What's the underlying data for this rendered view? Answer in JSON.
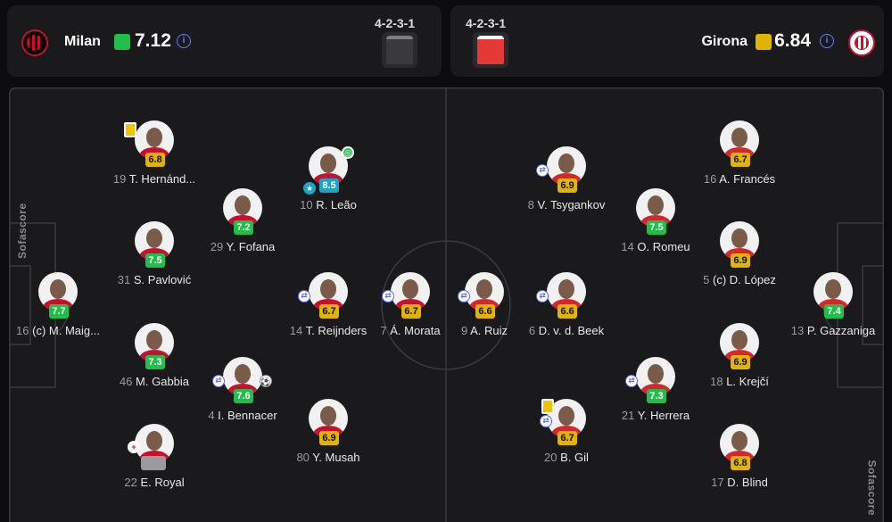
{
  "home": {
    "name": "Milan",
    "rating": "7.12",
    "formation": "4-2-3-1",
    "players": [
      {
        "num": "16",
        "name": "(c) M. Maig...",
        "rating": "7.7",
        "color": "green"
      },
      {
        "num": "19",
        "name": "T. Hernánd...",
        "rating": "6.8",
        "color": "yellow"
      },
      {
        "num": "31",
        "name": "S. Pavlović",
        "rating": "7.5",
        "color": "green"
      },
      {
        "num": "46",
        "name": "M. Gabbia",
        "rating": "7.3",
        "color": "green"
      },
      {
        "num": "22",
        "name": "E. Royal",
        "rating": "",
        "color": "grey"
      },
      {
        "num": "29",
        "name": "Y. Fofana",
        "rating": "7.2",
        "color": "green"
      },
      {
        "num": "4",
        "name": "I. Bennacer",
        "rating": "7.6",
        "color": "green"
      },
      {
        "num": "10",
        "name": "R. Leão",
        "rating": "8.5",
        "color": "teal"
      },
      {
        "num": "14",
        "name": "T. Reijnders",
        "rating": "6.7",
        "color": "yellow"
      },
      {
        "num": "80",
        "name": "Y. Musah",
        "rating": "6.9",
        "color": "yellow"
      },
      {
        "num": "7",
        "name": "Á. Morata",
        "rating": "6.7",
        "color": "yellow"
      }
    ]
  },
  "away": {
    "name": "Girona",
    "rating": "6.84",
    "formation": "4-2-3-1",
    "players": [
      {
        "num": "13",
        "name": "P. Gazzaniga",
        "rating": "7.4",
        "color": "green"
      },
      {
        "num": "16",
        "name": "A. Francés",
        "rating": "6.7",
        "color": "yellow"
      },
      {
        "num": "5",
        "name": "(c) D. López",
        "rating": "6.9",
        "color": "yellow"
      },
      {
        "num": "18",
        "name": "L. Krejčí",
        "rating": "6.9",
        "color": "yellow"
      },
      {
        "num": "17",
        "name": "D. Blind",
        "rating": "6.8",
        "color": "yellow"
      },
      {
        "num": "14",
        "name": "O. Romeu",
        "rating": "7.5",
        "color": "green"
      },
      {
        "num": "21",
        "name": "Y. Herrera",
        "rating": "7.3",
        "color": "green"
      },
      {
        "num": "8",
        "name": "V. Tsygankov",
        "rating": "6.9",
        "color": "yellow"
      },
      {
        "num": "6",
        "name": "D. v. d. Beek",
        "rating": "6.6",
        "color": "yellow"
      },
      {
        "num": "20",
        "name": "B. Gil",
        "rating": "6.7",
        "color": "yellow"
      },
      {
        "num": "9",
        "name": "A. Ruiz",
        "rating": "6.6",
        "color": "yellow"
      }
    ]
  },
  "brand": "Sofascore",
  "icons": {
    "info": "info-icon",
    "sub": "substitution-icon",
    "card": "yellow-card-icon",
    "star": "star-icon",
    "goal": "goal-icon",
    "assist": "assist-icon",
    "injury": "injury-icon"
  }
}
